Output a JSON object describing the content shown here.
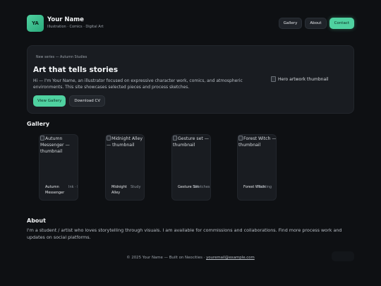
{
  "header": {
    "logo_text": "YA",
    "name": "Your Name",
    "subtitle": "Illustration · Comics · Digital Art",
    "nav": [
      "Gallery",
      "About",
      "Contact"
    ]
  },
  "hero": {
    "kicker": "New series — Autumn Studies",
    "title": "Art that tells stories",
    "text": "Hi — I'm Your Name, an illustrator focused on expressive character work, comics, and atmospheric environments. This site showcases selected pieces and process sketches.",
    "primary_button": "View Gallery",
    "secondary_button": "Download CV",
    "image_alt": "Hero artwork thumbnail"
  },
  "gallery": {
    "title": "Gallery",
    "cards": [
      {
        "alt": "Autumn Messenger — thumbnail",
        "title": "Autumn Messenger",
        "tag": "Ink · Digital"
      },
      {
        "alt": "Midnight Alley — thumbnail",
        "title": "Midnight Alley",
        "tag": "Study"
      },
      {
        "alt": "Gesture set — thumbnail",
        "title": "Gesture Set",
        "tag": "Sketches"
      },
      {
        "alt": "Forest Witch — thumbnail",
        "title": "Forest Witch",
        "tag": "Painting"
      }
    ]
  },
  "about": {
    "title": "About",
    "text": "I'm a student / artist who loves storytelling through visuals. I am available for commissions and collaborations. Find more process work and updates on social platforms."
  },
  "footer": {
    "text": "© 2025 Your Name — Built on Neocities ·",
    "email": "youremail@example.com"
  },
  "colors": {
    "accent": "#4fd1a0",
    "background": "#0e1013",
    "surface": "#191c21"
  }
}
